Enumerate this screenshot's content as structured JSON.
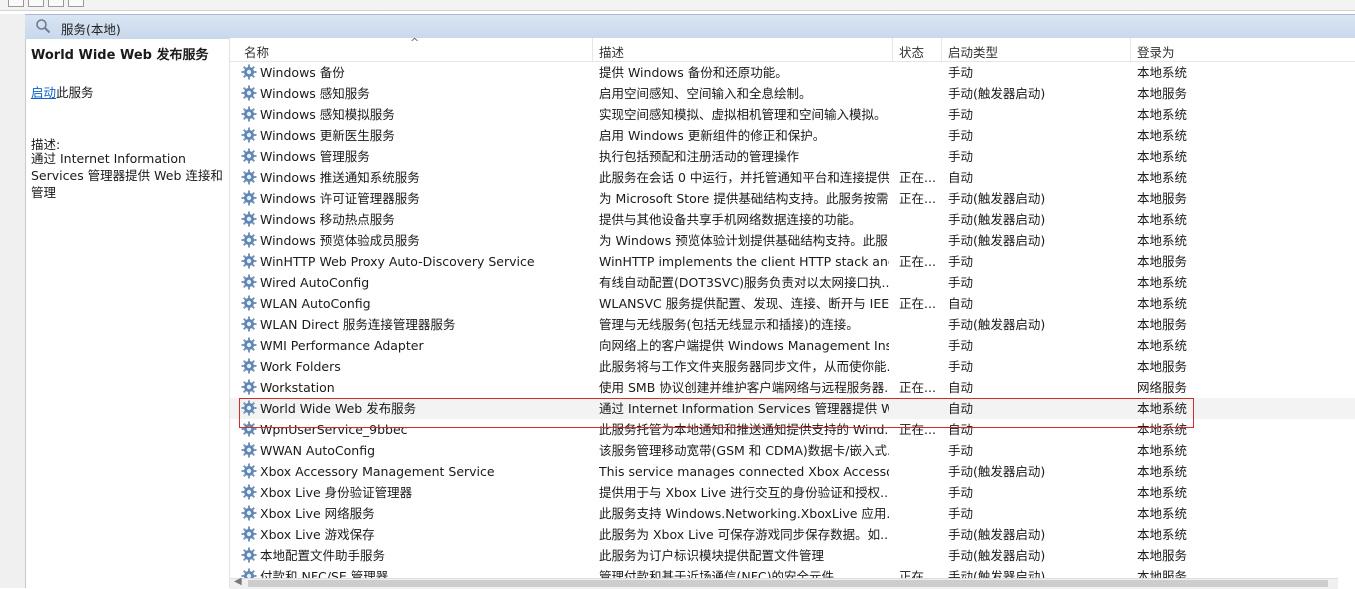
{
  "header": {
    "title": "服务(本地)"
  },
  "left_panel": {
    "service_title": "World Wide Web 发布服务",
    "action_link": "启动",
    "action_suffix": "此服务",
    "desc_label": "描述:",
    "desc_text": "通过 Internet Information Services 管理器提供 Web 连接和管理"
  },
  "columns": {
    "name": "名称",
    "desc": "描述",
    "state": "状态",
    "startup": "启动类型",
    "logon": "登录为",
    "sort_glyph": "^"
  },
  "rows": [
    {
      "name": "Windows 备份",
      "desc": "提供 Windows 备份和还原功能。",
      "state": "",
      "startup": "手动",
      "logon": "本地系统"
    },
    {
      "name": "Windows 感知服务",
      "desc": "启用空间感知、空间输入和全息绘制。",
      "state": "",
      "startup": "手动(触发器启动)",
      "logon": "本地服务"
    },
    {
      "name": "Windows 感知模拟服务",
      "desc": "实现空间感知模拟、虚拟相机管理和空间输入模拟。",
      "state": "",
      "startup": "手动",
      "logon": "本地系统"
    },
    {
      "name": "Windows 更新医生服务",
      "desc": "启用 Windows 更新组件的修正和保护。",
      "state": "",
      "startup": "手动",
      "logon": "本地系统"
    },
    {
      "name": "Windows 管理服务",
      "desc": "执行包括预配和注册活动的管理操作",
      "state": "",
      "startup": "手动",
      "logon": "本地系统"
    },
    {
      "name": "Windows 推送通知系统服务",
      "desc": "此服务在会话 0 中运行，并托管通知平台和连接提供...",
      "state": "正在...",
      "startup": "自动",
      "logon": "本地系统"
    },
    {
      "name": "Windows 许可证管理器服务",
      "desc": "为 Microsoft Store 提供基础结构支持。此服务按需...",
      "state": "正在...",
      "startup": "手动(触发器启动)",
      "logon": "本地服务"
    },
    {
      "name": "Windows 移动热点服务",
      "desc": "提供与其他设备共享手机网络数据连接的功能。",
      "state": "",
      "startup": "手动(触发器启动)",
      "logon": "本地系统"
    },
    {
      "name": "Windows 预览体验成员服务",
      "desc": "为 Windows 预览体验计划提供基础结构支持。此服...",
      "state": "",
      "startup": "手动(触发器启动)",
      "logon": "本地系统"
    },
    {
      "name": "WinHTTP Web Proxy Auto-Discovery Service",
      "desc": "WinHTTP implements the client HTTP stack and ...",
      "state": "正在...",
      "startup": "手动",
      "logon": "本地服务"
    },
    {
      "name": "Wired AutoConfig",
      "desc": "有线自动配置(DOT3SVC)服务负责对以太网接口执...",
      "state": "",
      "startup": "手动",
      "logon": "本地系统"
    },
    {
      "name": "WLAN AutoConfig",
      "desc": "WLANSVC 服务提供配置、发现、连接、断开与 IEE...",
      "state": "正在...",
      "startup": "自动",
      "logon": "本地系统"
    },
    {
      "name": "WLAN Direct 服务连接管理器服务",
      "desc": "管理与无线服务(包括无线显示和插接)的连接。",
      "state": "",
      "startup": "手动(触发器启动)",
      "logon": "本地服务"
    },
    {
      "name": "WMI Performance Adapter",
      "desc": "向网络上的客户端提供 Windows Management Ins...",
      "state": "",
      "startup": "手动",
      "logon": "本地系统"
    },
    {
      "name": "Work Folders",
      "desc": "此服务将与工作文件夹服务器同步文件，从而使你能...",
      "state": "",
      "startup": "手动",
      "logon": "本地服务"
    },
    {
      "name": "Workstation",
      "desc": "使用 SMB 协议创建并维护客户端网络与远程服务器...",
      "state": "正在...",
      "startup": "自动",
      "logon": "网络服务"
    },
    {
      "name": "World Wide Web 发布服务",
      "desc": "通过 Internet Information Services 管理器提供 W...",
      "state": "",
      "startup": "自动",
      "logon": "本地系统"
    },
    {
      "name": "WpnUserService_9bbec",
      "desc": "此服务托管为本地通知和推送通知提供支持的 Wind...",
      "state": "正在...",
      "startup": "自动",
      "logon": "本地系统"
    },
    {
      "name": "WWAN AutoConfig",
      "desc": "该服务管理移动宽带(GSM 和 CDMA)数据卡/嵌入式...",
      "state": "",
      "startup": "手动",
      "logon": "本地系统"
    },
    {
      "name": "Xbox Accessory Management Service",
      "desc": "This service manages connected Xbox Accessor...",
      "state": "",
      "startup": "手动(触发器启动)",
      "logon": "本地系统"
    },
    {
      "name": "Xbox Live 身份验证管理器",
      "desc": "提供用于与 Xbox Live 进行交互的身份验证和授权...",
      "state": "",
      "startup": "手动",
      "logon": "本地系统"
    },
    {
      "name": "Xbox Live 网络服务",
      "desc": "此服务支持 Windows.Networking.XboxLive 应用...",
      "state": "",
      "startup": "手动",
      "logon": "本地系统"
    },
    {
      "name": "Xbox Live 游戏保存",
      "desc": "此服务为 Xbox Live 可保存游戏同步保存数据。如...",
      "state": "",
      "startup": "手动(触发器启动)",
      "logon": "本地系统"
    },
    {
      "name": "本地配置文件助手服务",
      "desc": "此服务为订户标识模块提供配置文件管理",
      "state": "",
      "startup": "手动(触发器启动)",
      "logon": "本地服务"
    },
    {
      "name": "付款和 NFC/SE 管理器",
      "desc": "管理付款和基于近场通信(NFC)的安全元件。",
      "state": "正在...",
      "startup": "手动(触发器启动)",
      "logon": "本地服务"
    }
  ],
  "selected_row_index": 16,
  "icons": {
    "panel": "search-services-icon",
    "row": "gear-icon"
  },
  "colors": {
    "header_bg": "#c8d8ec",
    "link": "#0b63c9",
    "highlight": "#d42b2b",
    "gear": "#2d6fb6"
  }
}
